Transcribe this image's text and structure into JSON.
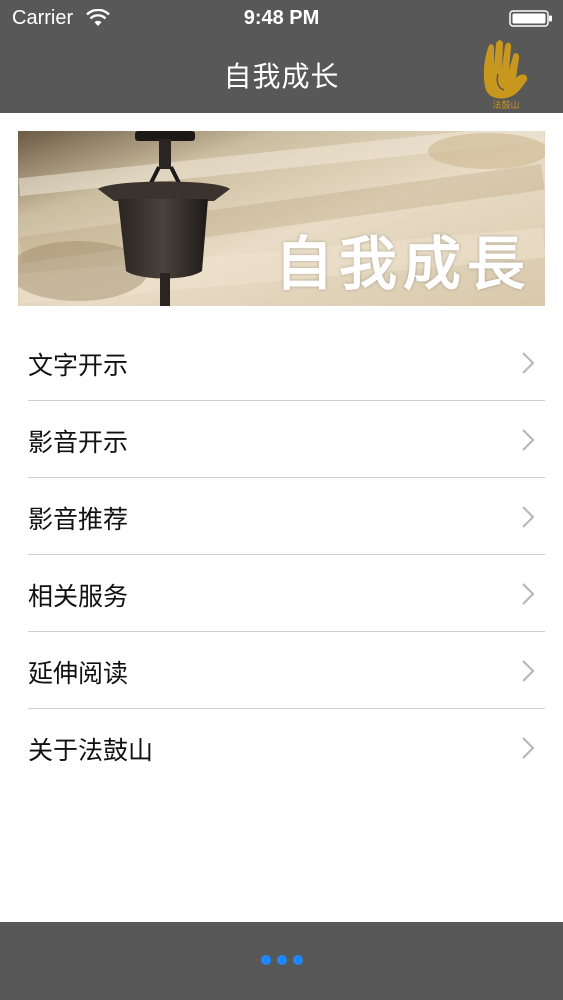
{
  "status_bar": {
    "carrier": "Carrier",
    "time": "9:48 PM",
    "wifi_icon": "wifi-icon",
    "battery_icon": "battery-icon"
  },
  "nav": {
    "title": "自我成长",
    "logo_text": "法鼓山"
  },
  "banner": {
    "text": "自我成長"
  },
  "menu": {
    "items": [
      {
        "label": "文字开示"
      },
      {
        "label": "影音开示"
      },
      {
        "label": "影音推荐"
      },
      {
        "label": "相关服务"
      },
      {
        "label": "延伸阅读"
      },
      {
        "label": "关于法鼓山"
      }
    ]
  },
  "footer": {
    "more_icon": "more-dots-icon",
    "accent_color": "#1e88ff"
  },
  "colors": {
    "bar_background": "#585858",
    "page_background": "#ffffff",
    "logo_color": "#c8971e"
  }
}
